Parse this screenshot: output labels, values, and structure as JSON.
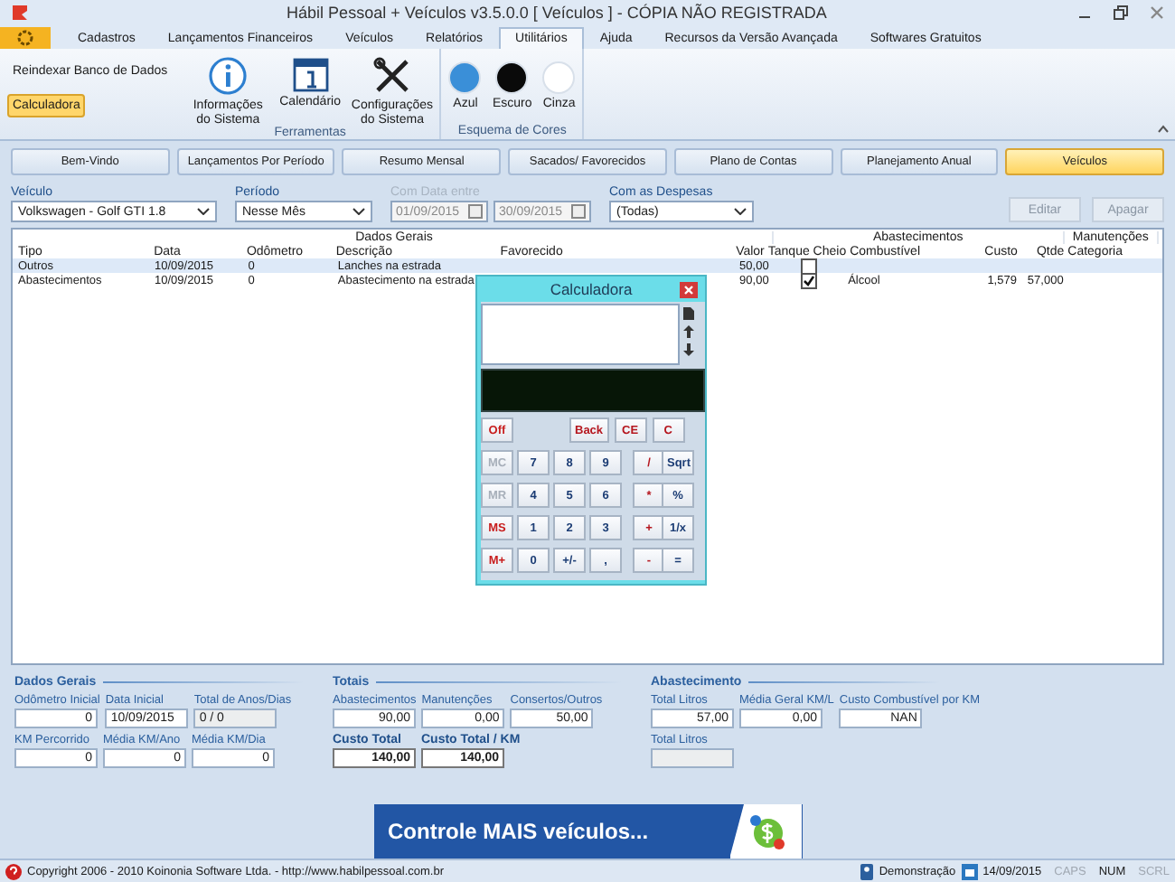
{
  "window": {
    "title": "Hábil Pessoal + Veículos v3.5.0.0 [ Veículos ] - CÓPIA NÃO REGISTRADA"
  },
  "ribbon_tabs": [
    {
      "label": "Cadastros",
      "selected": false
    },
    {
      "label": "Lançamentos Financeiros",
      "selected": false
    },
    {
      "label": "Veículos",
      "selected": false
    },
    {
      "label": "Relatórios",
      "selected": false
    },
    {
      "label": "Utilitários",
      "selected": true
    },
    {
      "label": "Ajuda",
      "selected": false
    },
    {
      "label": "Recursos da Versão Avançada",
      "selected": false
    },
    {
      "label": "Softwares Gratuitos",
      "selected": false
    }
  ],
  "ribbon": {
    "small_items": [
      {
        "label": "Reindexar Banco de Dados",
        "selected": false
      },
      {
        "label": "Calculadora",
        "selected": true
      }
    ],
    "tools_group": {
      "label": "Ferramentas",
      "items": [
        {
          "kind": "info",
          "label": "Informações do Sistema"
        },
        {
          "kind": "calendar",
          "label": "Calendário"
        },
        {
          "kind": "tools",
          "label": "Configurações do Sistema"
        }
      ]
    },
    "colors_group": {
      "label": "Esquema de Cores",
      "items": [
        {
          "label": "Azul",
          "color": "#3a8fd8"
        },
        {
          "label": "Escuro",
          "color": "#0a0a0a"
        },
        {
          "label": "Cinza",
          "color": "#ffffff"
        }
      ]
    }
  },
  "nav_buttons": [
    {
      "label": "Bem-Vindo",
      "selected": false
    },
    {
      "label": "Lançamentos Por Período",
      "selected": false
    },
    {
      "label": "Resumo Mensal",
      "selected": false
    },
    {
      "label": "Sacados/ Favorecidos",
      "selected": false
    },
    {
      "label": "Plano de Contas",
      "selected": false
    },
    {
      "label": "Planejamento Anual",
      "selected": false
    },
    {
      "label": "Veículos",
      "selected": true
    }
  ],
  "filters": {
    "vehicle": {
      "label": "Veículo",
      "value": "Volkswagen - Golf GTI 1.8"
    },
    "period": {
      "label": "Período",
      "value": "Nesse Mês"
    },
    "date_range": {
      "label": "Com Data entre",
      "disabled": true,
      "from": "01/09/2015",
      "to": "30/09/2015"
    },
    "expenses": {
      "label": "Com as Despesas",
      "value": "(Todas)"
    },
    "buttons": [
      {
        "label": "Editar",
        "disabled": true
      },
      {
        "label": "Apagar",
        "disabled": true
      }
    ]
  },
  "table": {
    "groups": [
      "Dados Gerais",
      "Abastecimentos",
      "Manutenções"
    ],
    "columns": [
      "Tipo",
      "Data",
      "Odômetro",
      "Descrição",
      "Favorecido",
      "Valor",
      "Tanque Cheio",
      "Combustível",
      "Custo",
      "Qtde",
      "Categoria"
    ],
    "rows": [
      {
        "selected": true,
        "tipo": "Outros",
        "data": "10/09/2015",
        "odometro": "0",
        "descricao": "Lanches na estrada",
        "valor": "50,00",
        "tanque_cheio": false
      },
      {
        "selected": false,
        "tipo": "Abastecimentos",
        "data": "10/09/2015",
        "odometro": "0",
        "descricao": "Abastecimento na estrada",
        "valor": "90,00",
        "tanque_cheio": true,
        "combustivel": "Álcool",
        "custo": "1,579",
        "qtde": "57,000"
      }
    ]
  },
  "calculator": {
    "title": "Calculadora",
    "top_keys": [
      {
        "label": "Off",
        "kind": "mem"
      },
      {
        "label": "Back",
        "kind": "op"
      },
      {
        "label": "CE",
        "kind": "op"
      },
      {
        "label": "C",
        "kind": "op"
      }
    ],
    "keys": [
      {
        "label": "MC",
        "kind": "mem",
        "disabled": true
      },
      {
        "label": "7",
        "kind": "num"
      },
      {
        "label": "8",
        "kind": "num"
      },
      {
        "label": "9",
        "kind": "num"
      },
      {
        "label": "/",
        "kind": "op"
      },
      {
        "label": "Sqrt",
        "kind": "fn"
      },
      {
        "label": "MR",
        "kind": "mem",
        "disabled": true
      },
      {
        "label": "4",
        "kind": "num"
      },
      {
        "label": "5",
        "kind": "num"
      },
      {
        "label": "6",
        "kind": "num"
      },
      {
        "label": "*",
        "kind": "op"
      },
      {
        "label": "%",
        "kind": "fn"
      },
      {
        "label": "MS",
        "kind": "mem",
        "disabled": false
      },
      {
        "label": "1",
        "kind": "num"
      },
      {
        "label": "2",
        "kind": "num"
      },
      {
        "label": "3",
        "kind": "num"
      },
      {
        "label": "+",
        "kind": "op"
      },
      {
        "label": "1/x",
        "kind": "fn"
      },
      {
        "label": "M+",
        "kind": "mem",
        "disabled": false
      },
      {
        "label": "0",
        "kind": "num"
      },
      {
        "label": "+/-",
        "kind": "num"
      },
      {
        "label": ",",
        "kind": "num"
      },
      {
        "label": "-",
        "kind": "op"
      },
      {
        "label": "=",
        "kind": "fn"
      }
    ]
  },
  "summary": [
    {
      "title": "Dados Gerais",
      "rows": [
        [
          {
            "label": "Odômetro Inicial",
            "value": "0",
            "kind": "number"
          },
          {
            "label": "Data Inicial",
            "value": "10/09/2015",
            "kind": "text"
          },
          {
            "label": "Total de Anos/Dias",
            "value": "0 / 0",
            "kind": "readonly"
          }
        ],
        [
          {
            "label": "KM Percorrido",
            "value": "0",
            "kind": "number"
          },
          {
            "label": "Média KM/Ano",
            "value": "0",
            "kind": "number"
          },
          {
            "label": "Média KM/Dia",
            "value": "0",
            "kind": "number"
          }
        ]
      ]
    },
    {
      "title": "Totais",
      "rows": [
        [
          {
            "label": "Abastecimentos",
            "value": "90,00",
            "kind": "number"
          },
          {
            "label": "Manutenções",
            "value": "0,00",
            "kind": "number"
          },
          {
            "label": "Consertos/Outros",
            "value": "50,00",
            "kind": "number"
          }
        ],
        [
          {
            "label": "Custo Total",
            "value": "140,00",
            "kind": "total"
          },
          {
            "label": "Custo Total / KM",
            "value": "140,00",
            "kind": "total"
          }
        ]
      ]
    },
    {
      "title": "Abastecimento",
      "rows": [
        [
          {
            "label": "Total Litros",
            "value": "57,00",
            "kind": "number"
          },
          {
            "label": "Média Geral KM/L",
            "value": "0,00",
            "kind": "number"
          },
          {
            "label": "Custo Combustível por KM",
            "value": "NAN",
            "kind": "number"
          }
        ],
        [
          {
            "label": "Total Litros",
            "kind": "readonly"
          }
        ]
      ]
    }
  ],
  "banner": {
    "text": "Controle MAIS veículos..."
  },
  "status_bar": {
    "copyright": "Copyright 2006 - 2010 Koinonia Software Ltda. - http://www.habilpessoal.com.br",
    "user": "Demonstração",
    "date": "14/09/2015",
    "indicators": [
      {
        "label": "CAPS",
        "on": false
      },
      {
        "label": "NUM",
        "on": true
      },
      {
        "label": "SCRL",
        "on": false
      }
    ]
  }
}
